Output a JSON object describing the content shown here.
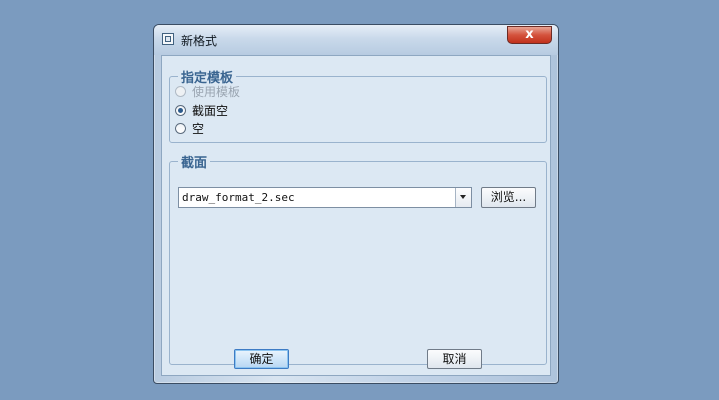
{
  "window": {
    "title": "新格式",
    "close_symbol": "x"
  },
  "template_group": {
    "legend": "指定模板",
    "options": [
      {
        "label": "使用模板",
        "checked": false,
        "disabled": true
      },
      {
        "label": "截面空",
        "checked": true,
        "disabled": false
      },
      {
        "label": "空",
        "checked": false,
        "disabled": false
      }
    ]
  },
  "section_group": {
    "legend": "截面",
    "file_value": "draw_format_2.sec",
    "browse_label": "浏览..."
  },
  "buttons": {
    "ok_label": "确定",
    "cancel_label": "取消"
  },
  "colors": {
    "desktop": "#7b9bbf",
    "legend": "#3a6591",
    "close_button": "#c1311c"
  }
}
